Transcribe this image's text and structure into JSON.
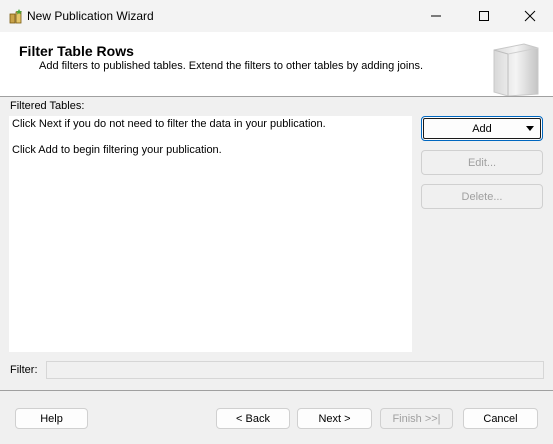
{
  "window": {
    "title": "New Publication Wizard",
    "minimize_icon": "minimize-icon",
    "maximize_icon": "maximize-icon",
    "close_icon": "close-icon"
  },
  "header": {
    "title": "Filter Table Rows",
    "subtitle": "Add filters to published tables. Extend the filters to other tables by adding joins."
  },
  "filtered_tables": {
    "label": "Filtered Tables:",
    "lines": [
      "Click Next if you do not need to filter the data in your publication.",
      "Click Add to begin filtering your publication."
    ]
  },
  "side_buttons": {
    "add": "Add",
    "edit": "Edit...",
    "delete": "Delete..."
  },
  "filter": {
    "label": "Filter:",
    "value": ""
  },
  "footer": {
    "help": "Help",
    "back": "< Back",
    "next": "Next >",
    "finish": "Finish >>|",
    "cancel": "Cancel"
  },
  "colors": {
    "accent": "#0067c0",
    "disabled_text": "#a0a0a0",
    "background": "#f0f0f0"
  }
}
